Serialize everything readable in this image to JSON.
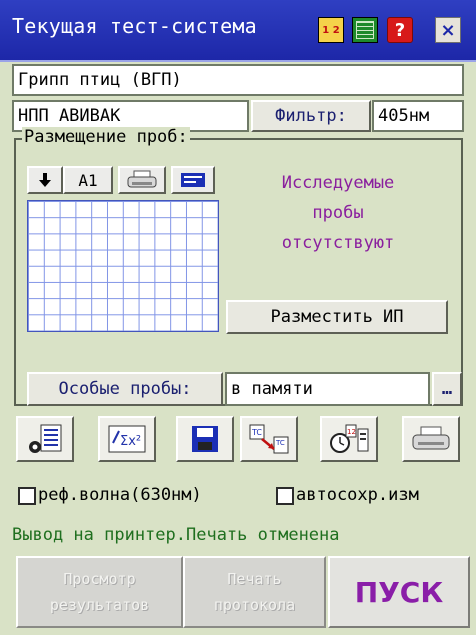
{
  "window": {
    "title": "Текущая тест-система",
    "icons": [
      "calculator-icon",
      "grid-table-icon",
      "help-icon",
      "close-icon"
    ],
    "close_glyph": "×",
    "help_glyph": "?",
    "calc_glyph": "1 2"
  },
  "test": {
    "name": "Грипп птиц (ВГП)",
    "kit": "НПП АВИВАК",
    "filter_label": "Фильтр:",
    "filter_value": "405нм"
  },
  "placement": {
    "title": "Размещение проб:",
    "tools": [
      "arrow-down-icon",
      "A1",
      "printer-icon",
      "keyboard-icon"
    ],
    "start_cell": "A1",
    "grid": {
      "columns": 12,
      "rows": 8
    },
    "message_lines": [
      "Исследуемые",
      "пробы",
      "отсутствуют"
    ],
    "place_button": "Разместить ИП",
    "special_label": "Особые пробы:",
    "special_value": "в памяти",
    "browse_glyph": "…"
  },
  "toolbar": {
    "icons": [
      "calibration-table-icon",
      "formula-icon",
      "save-icon",
      "control-to-test-icon",
      "timer-schedule-icon",
      "printer-icon"
    ]
  },
  "options": {
    "ref_wave_label": "реф.волна(630нм)",
    "ref_wave_checked": false,
    "autosave_label": "автосохр.изм",
    "autosave_checked": false
  },
  "status_text": "Вывод на принтер.Печать отменена",
  "actions": {
    "view_results": [
      "Просмотр",
      "результатов"
    ],
    "print_protocol": [
      "Печать",
      "протокола"
    ],
    "run": "ПУСК"
  },
  "colors": {
    "titlebar": "#1d27a8",
    "background": "#d9e2c6",
    "accent_purple": "#8a1f9e",
    "status_green": "#1f6f1f"
  }
}
